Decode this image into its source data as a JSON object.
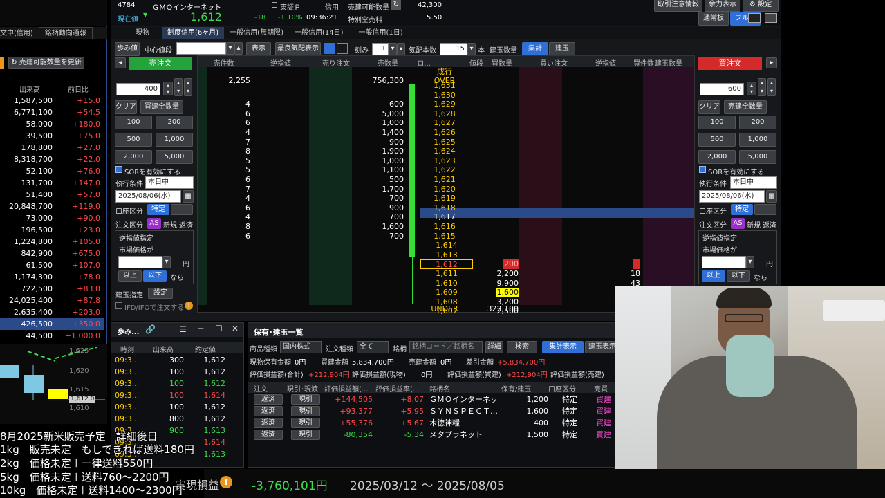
{
  "header": {
    "code": "4784",
    "name": "ＧＭＯインターネット",
    "price_label": "現在値",
    "price": "1,612",
    "change": "-18",
    "change_pct": "-1.10%",
    "time": "09:36:21",
    "market": "東証Ｐ",
    "credit": "信用",
    "sell_available_label": "売建可能数量",
    "sell_available": "42,300",
    "special_label": "特別空売料",
    "special": "5.50",
    "btn_notice": "取引注意情報",
    "btn_capacity": "余力表示",
    "btn_settings": "設定",
    "btn_normal": "通常板",
    "btn_full": "フル板"
  },
  "left_tabs": {
    "t1": "文中(信用)",
    "t2": "銘柄動向通報"
  },
  "left": {
    "update_btn": "売建可能数量を更新",
    "col_volume": "出来高",
    "col_change": "前日比",
    "rows": [
      {
        "v": "1,587,500",
        "c": "+15.0"
      },
      {
        "v": "6,771,100",
        "c": "+54.5"
      },
      {
        "v": "58,000",
        "c": "+180.0"
      },
      {
        "v": "39,500",
        "c": "+75.0"
      },
      {
        "v": "178,800",
        "c": "+27.0"
      },
      {
        "v": "8,318,700",
        "c": "+22.0"
      },
      {
        "v": "52,100",
        "c": "+76.0"
      },
      {
        "v": "131,700",
        "c": "+147.0"
      },
      {
        "v": "51,400",
        "c": "+57.0"
      },
      {
        "v": "20,848,700",
        "c": "+119.0"
      },
      {
        "v": "73,000",
        "c": "+90.0"
      },
      {
        "v": "196,500",
        "c": "+23.0"
      },
      {
        "v": "1,224,800",
        "c": "+105.0"
      },
      {
        "v": "842,900",
        "c": "+675.0"
      },
      {
        "v": "61,500",
        "c": "+107.0"
      },
      {
        "v": "1,174,300",
        "c": "+78.0"
      },
      {
        "v": "722,500",
        "c": "+83.0"
      },
      {
        "v": "24,025,400",
        "c": "+87.8"
      },
      {
        "v": "2,635,400",
        "c": "+203.0"
      },
      {
        "v": "426,500",
        "c": "+350.0"
      },
      {
        "v": "44,500",
        "c": "+1,000.0"
      }
    ]
  },
  "tabs": {
    "t1": "現物",
    "t2": "制度信用(6ヶ月)",
    "t3": "一般信用(無期限)",
    "t4": "一般信用(14日)",
    "t5": "一般信用(1日)"
  },
  "toolbar": {
    "step": "歩み値",
    "center": "中心値段",
    "show": "表示",
    "last_quote": "最良気配表示",
    "tick": "刻み",
    "tick_val": "1",
    "quote_count": "気配本数",
    "quote_count_val": "15",
    "unit": "本",
    "position_qty": "建玉数量",
    "sum": "集計",
    "position": "建玉"
  },
  "sell_panel": {
    "title": "売注文",
    "qty": "400",
    "clear": "クリア",
    "all_buy": "買建全数量",
    "q100": "100",
    "q200": "200",
    "q500": "500",
    "q1000": "1,000",
    "q2000": "2,000",
    "q5000": "5,000",
    "sor": "SORを有効にする",
    "exec_label": "執行条件",
    "exec": "本日中",
    "date": "2025/08/06(水)",
    "account_label": "口座区分",
    "account": "特定",
    "order_label": "注文区分",
    "as": "AS",
    "new": "新規",
    "repay": "返済",
    "stop_title": "逆指値指定",
    "market_label": "市場価格が",
    "yen": "円",
    "above": "以上",
    "below": "以下",
    "nara": "なら",
    "pos_label": "建玉指定",
    "pos_set": "設定",
    "ifd": "IFD/IFOで注文する"
  },
  "buy_panel": {
    "title": "買注文",
    "qty": "600",
    "clear": "クリア",
    "all_sell": "売建全数量",
    "q100": "100",
    "q200": "200",
    "q500": "500",
    "q1000": "1,000",
    "q2000": "2,000",
    "q5000": "5,000",
    "sor": "SORを有効にする",
    "exec_label": "執行条件",
    "exec": "本日中",
    "date": "2025/08/06(水)",
    "account_label": "口座区分",
    "account": "特定",
    "order_label": "注文区分",
    "as": "AS",
    "new": "新規",
    "repay": "返済",
    "stop_title": "逆指値指定",
    "market_label": "市場価格が",
    "yen": "円",
    "above": "以上",
    "below": "以下",
    "nara": "なら"
  },
  "board": {
    "headers": [
      "売件数",
      "逆指値",
      "売り注文",
      "売数量",
      "ロ...",
      "値段",
      "買数量",
      "買い注文",
      "逆指値",
      "買件数",
      "建玉数量"
    ],
    "market_order": "成行",
    "over_cnt": "2,255",
    "over_qty": "756,300",
    "over": "OVER",
    "sell_rows": [
      {
        "p": "1,631",
        "n": "",
        "q": ""
      },
      {
        "p": "1,630",
        "n": "",
        "q": ""
      },
      {
        "p": "1,629",
        "n": "4",
        "q": "600"
      },
      {
        "p": "1,628",
        "n": "6",
        "q": "5,000"
      },
      {
        "p": "1,627",
        "n": "6",
        "q": "1,000"
      },
      {
        "p": "1,626",
        "n": "4",
        "q": "1,400"
      },
      {
        "p": "1,625",
        "n": "7",
        "q": "900"
      },
      {
        "p": "1,624",
        "n": "8",
        "q": "1,900"
      },
      {
        "p": "1,623",
        "n": "5",
        "q": "1,000"
      },
      {
        "p": "1,622",
        "n": "5",
        "q": "1,100"
      },
      {
        "p": "1,621",
        "n": "6",
        "q": "500"
      },
      {
        "p": "1,620",
        "n": "7",
        "q": "1,700"
      },
      {
        "p": "1,619",
        "n": "4",
        "q": "700"
      },
      {
        "p": "1,618",
        "n": "6",
        "q": "900"
      },
      {
        "p": "1,617",
        "n": "4",
        "q": "700"
      },
      {
        "p": "1,616",
        "n": "8",
        "q": "1,600"
      },
      {
        "p": "1,615",
        "n": "6",
        "q": "700"
      }
    ],
    "buy_rows": [
      {
        "p": "1,614",
        "q": "",
        "n": ""
      },
      {
        "p": "1,613",
        "q": "",
        "n": ""
      },
      {
        "p": "1,612",
        "q": "200",
        "n": "2"
      },
      {
        "p": "1,611",
        "q": "2,200",
        "n": "18"
      },
      {
        "p": "1,610",
        "q": "9,900",
        "n": "43"
      },
      {
        "p": "1,609",
        "q": "1,600",
        "n": "7"
      },
      {
        "p": "1,608",
        "q": "3,200",
        "n": ""
      },
      {
        "p": "1,607",
        "q": "2,500",
        "n": ""
      }
    ],
    "under": "UNDER",
    "under_qty": "322,100"
  },
  "ticks": {
    "title": "歩み...",
    "col_time": "時刻",
    "col_vol": "出来高",
    "col_price": "約定値",
    "rows": [
      {
        "t": "09:3...",
        "v": "300",
        "p": "1,612",
        "c": "wht"
      },
      {
        "t": "09:3...",
        "v": "100",
        "p": "1,612",
        "c": "wht"
      },
      {
        "t": "09:3...",
        "v": "100",
        "p": "1,612",
        "c": "grn"
      },
      {
        "t": "09:3...",
        "v": "100",
        "p": "1,614",
        "c": "red"
      },
      {
        "t": "09:3...",
        "v": "100",
        "p": "1,612",
        "c": "wht"
      },
      {
        "t": "09:3...",
        "v": "800",
        "p": "1,612",
        "c": "wht"
      },
      {
        "t": "09:3...",
        "v": "900",
        "p": "1,613",
        "c": "grn"
      },
      {
        "t": "09:3...",
        "v": "",
        "p": "1,614",
        "c": "red"
      },
      {
        "t": "09:3...",
        "v": "",
        "p": "1,613",
        "c": "grn"
      }
    ]
  },
  "holdings": {
    "title": "保有･建玉一覧",
    "type_label": "商品種類",
    "type": "国内株式",
    "order_type_label": "注文種類",
    "order_type": "全て",
    "stock_label": "銘柄",
    "stock_ph": "銘柄コード／銘柄名",
    "detail": "詳細",
    "search": "検索",
    "sum_view": "集計表示",
    "pos_view": "建玉表示",
    "s1l": "現物保有金額",
    "s1": "0円",
    "s2l": "買建金額",
    "s2": "5,834,700円",
    "s3l": "売建金額",
    "s3": "0円",
    "s4l": "差引金額",
    "s4": "+5,834,700円",
    "s5l": "評価損益額(合計)",
    "s5": "+212,904円",
    "s6l": "評価損益額(現物)",
    "s6": "0円",
    "s7l": "評価損益額(買建)",
    "s7": "+212,904円",
    "s8l": "評価損益額(売建)",
    "cols": [
      "注文",
      "現引･現渡",
      "評価損益額(...",
      "評価損益率(...",
      "銘柄名",
      "保有/建玉",
      "口座区分",
      "売買"
    ],
    "rows": [
      {
        "a": "返済",
        "b": "現引",
        "pl": "+144,505",
        "pr": "+8.07",
        "name": "ＧＭＯインターネット",
        "qty": "1,200",
        "acc": "特定",
        "side": "買建"
      },
      {
        "a": "返済",
        "b": "現引",
        "pl": "+93,377",
        "pr": "+5.95",
        "name": "ＳＹＮＳＰＥＣＴ…",
        "qty": "1,600",
        "acc": "特定",
        "side": "買建"
      },
      {
        "a": "返済",
        "b": "現引",
        "pl": "+55,376",
        "pr": "+5.67",
        "name": "木徳神糧",
        "qty": "400",
        "acc": "特定",
        "side": "買建"
      },
      {
        "a": "返済",
        "b": "現引",
        "pl": "-80,354",
        "pr": "-5.34",
        "name": "メタプラネット",
        "qty": "1,500",
        "acc": "特定",
        "side": "買建"
      }
    ]
  },
  "chart": {
    "y1": "1,625",
    "y2": "1,620",
    "y3": "1,615",
    "y4": "1,610",
    "last": "1,612.0"
  },
  "overlay": {
    "l1": "8月2025新米販売予定　詳細後日",
    "l2": "1kg　販売未定　もしできれば送料180円",
    "l3": "2kg　価格未定＋一律送料550円",
    "l4": "5kg　価格未定＋送料760～2200円",
    "l5": "10kg　価格未定＋送料1400～2300円"
  },
  "footer": {
    "label": "実現損益",
    "pl": "-3,760,101円",
    "range": "2025/03/12 ～ 2025/08/05"
  },
  "colors": {
    "bg": "#000000",
    "accent": "#2f6fd6",
    "sell": "#2fa84f",
    "buy": "#d42a2a",
    "up": "#ff4a4a",
    "down": "#3ddc4a"
  }
}
